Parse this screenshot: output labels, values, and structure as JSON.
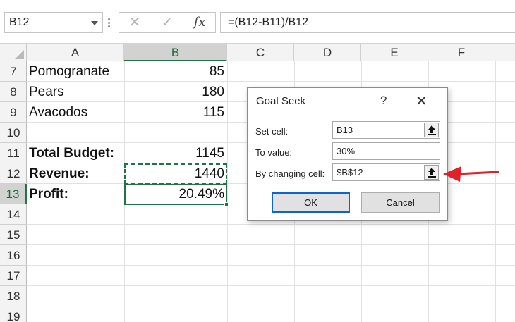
{
  "formula_bar": {
    "name_box": "B12",
    "cancel_glyph": "✕",
    "enter_glyph": "✓",
    "fx_label": "fx",
    "formula": "=(B12-B11)/B12"
  },
  "columns": [
    "A",
    "B",
    "C",
    "D",
    "E",
    "F"
  ],
  "rows": [
    "7",
    "8",
    "9",
    "10",
    "11",
    "12",
    "13",
    "14",
    "15",
    "16",
    "17",
    "18",
    "19"
  ],
  "cells": [
    {
      "row": "7",
      "a": "Pomogranate",
      "b": "85",
      "bold": false
    },
    {
      "row": "8",
      "a": "Pears",
      "b": "180",
      "bold": false
    },
    {
      "row": "9",
      "a": "Avacodos",
      "b": "115",
      "bold": false
    },
    {
      "row": "11",
      "a": "Total Budget:",
      "b": "1145",
      "bold": true
    },
    {
      "row": "12",
      "a": "Revenue:",
      "b": "1440",
      "bold": true
    },
    {
      "row": "13",
      "a": "Profit:",
      "b": "20.49%",
      "bold": true
    }
  ],
  "dialog": {
    "title": "Goal Seek",
    "help": "?",
    "close": "✕",
    "set_cell_label": "Set cell:",
    "set_cell_value": "B13",
    "to_value_label": "To value:",
    "to_value_value": "30%",
    "changing_label": "By changing cell:",
    "changing_value": "$B$12",
    "ok": "OK",
    "cancel": "Cancel"
  },
  "colors": {
    "selection": "#217346",
    "arrow": "#e0202a",
    "ok_focus": "#0a64d2"
  }
}
